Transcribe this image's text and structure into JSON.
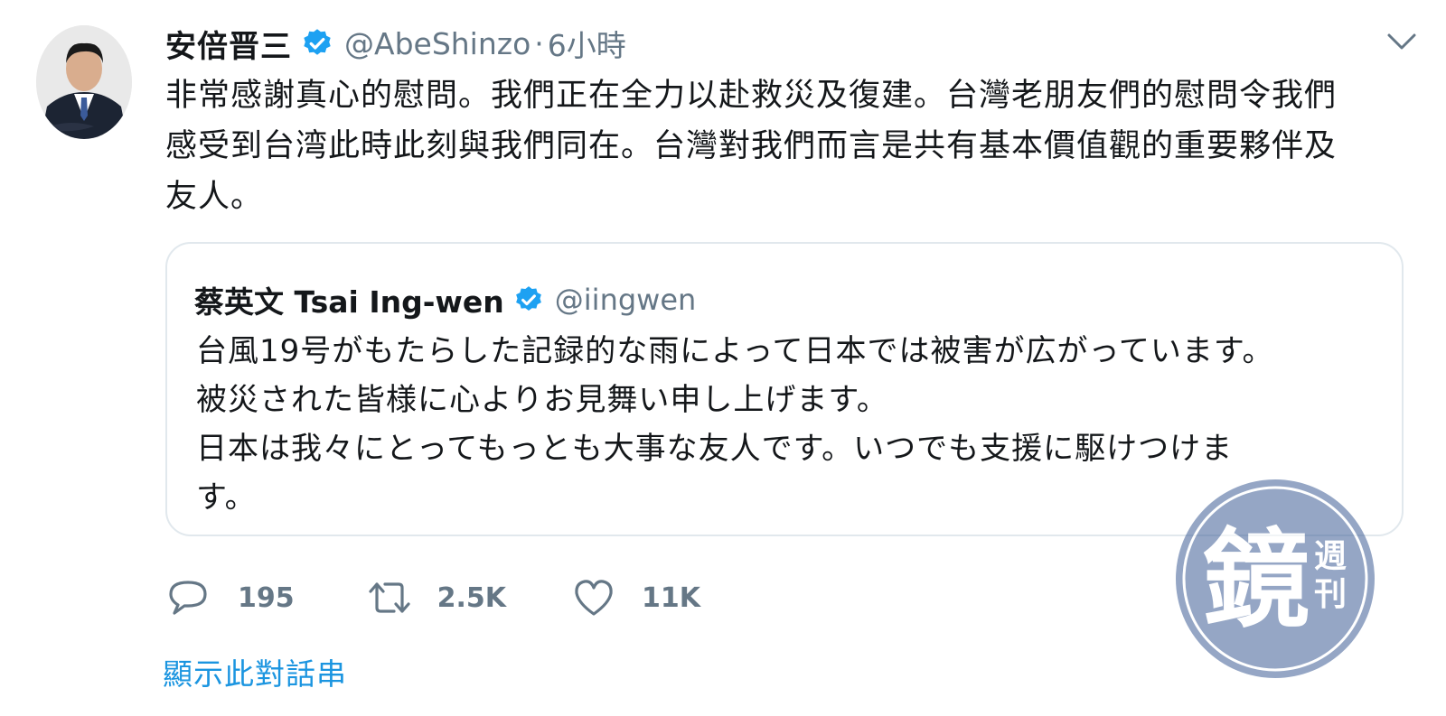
{
  "tweet": {
    "author_name": "安倍晋三",
    "author_handle": "@AbeShinzo",
    "separator": "·",
    "time": "6小時",
    "text_lines": [
      "非常感謝真心的慰問。我們正在全力以赴救災及復建。台灣老朋友們的慰問令我們",
      "感受到台湾此時此刻與我們同在。台灣對我們而言是共有基本價值觀的重要夥伴及",
      "友人。"
    ]
  },
  "quoted_tweet": {
    "author_name": "蔡英文 Tsai Ing-wen",
    "author_handle": "@iingwen",
    "text_lines": [
      "台風19号がもたらした記録的な雨によって日本では被害が広がっています。",
      "被災された皆様に心よりお見舞い申し上げます。",
      "日本は我々にとってもっとも大事な友人です。いつでも支援に駆けつけま",
      "す。"
    ]
  },
  "actions": {
    "reply_count": "195",
    "retweet_count": "2.5K",
    "like_count": "11K"
  },
  "show_thread_label": "顯示此對話串",
  "watermark": {
    "main_char": "鏡",
    "side_chars": "週刊"
  },
  "icons": {
    "verified": "verified-badge-icon",
    "caret": "chevron-down-icon",
    "reply": "reply-icon",
    "retweet": "retweet-icon",
    "like": "heart-icon"
  },
  "colors": {
    "verified_blue": "#1da1f2",
    "secondary_text": "#657786",
    "link_blue": "#1b95e0",
    "border": "#e1e8ed"
  }
}
